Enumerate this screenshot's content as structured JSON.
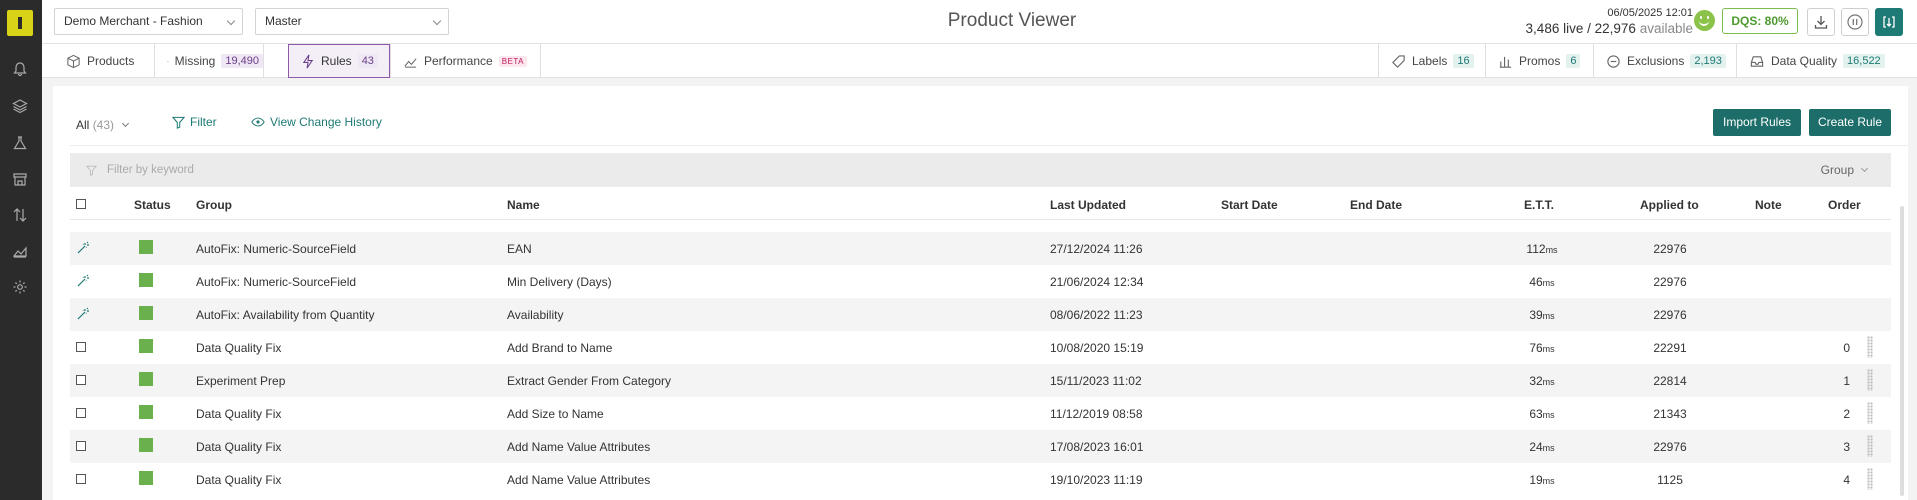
{
  "header": {
    "merchant": "Demo Merchant - Fashion",
    "catalog": "Master",
    "title": "Product Viewer",
    "datetime": "06/05/2025 12:01",
    "live_count": "3,486",
    "live_label": "live /",
    "total_count": "22,976",
    "available_label": "available",
    "dqs": "DQS: 80%"
  },
  "tabs": [
    {
      "label": "Products",
      "icon": "box-icon"
    },
    {
      "label": "Missing",
      "count": "19,490",
      "icon": "missing-icon"
    },
    {
      "label": "Rules",
      "count": "43",
      "icon": "lightning-icon"
    },
    {
      "label": "Performance",
      "beta": "BETA",
      "icon": "chart-icon"
    }
  ],
  "right_tabs": [
    {
      "label": "Labels",
      "count": "16",
      "icon": "tag-icon"
    },
    {
      "label": "Promos",
      "count": "6",
      "icon": "bar-chart-icon"
    },
    {
      "label": "Exclusions",
      "count": "2,193",
      "icon": "minus-circle-icon"
    },
    {
      "label": "Data Quality",
      "count": "16,522",
      "icon": "inbox-icon"
    }
  ],
  "toolbar": {
    "all_label": "All",
    "all_count": "(43)",
    "filter_label": "Filter",
    "history_label": "View Change History",
    "import_label": "Import Rules",
    "create_label": "Create Rule"
  },
  "filterbar": {
    "placeholder": "Filter by keyword",
    "group_label": "Group"
  },
  "table": {
    "headers": {
      "status": "Status",
      "group": "Group",
      "name": "Name",
      "updated": "Last Updated",
      "start": "Start Date",
      "end": "End Date",
      "ett": "E.T.T.",
      "applied": "Applied to",
      "note": "Note",
      "order": "Order"
    },
    "rows": [
      {
        "autofix": true,
        "group": "AutoFix: Numeric-SourceField",
        "name": "EAN",
        "updated": "27/12/2024 11:26",
        "ett": "112",
        "unit": "ms",
        "applied": "22976",
        "order": ""
      },
      {
        "autofix": true,
        "group": "AutoFix: Numeric-SourceField",
        "name": "Min Delivery (Days)",
        "updated": "21/06/2024 12:34",
        "ett": "46",
        "unit": "ms",
        "applied": "22976",
        "order": ""
      },
      {
        "autofix": true,
        "group": "AutoFix: Availability from Quantity",
        "name": "Availability",
        "updated": "08/06/2022 11:23",
        "ett": "39",
        "unit": "ms",
        "applied": "22976",
        "order": ""
      },
      {
        "autofix": false,
        "group": "Data Quality Fix",
        "name": "Add Brand to Name",
        "updated": "10/08/2020 15:19",
        "ett": "76",
        "unit": "ms",
        "applied": "22291",
        "order": "0"
      },
      {
        "autofix": false,
        "group": "Experiment Prep",
        "name": "Extract Gender From Category",
        "updated": "15/11/2023 11:02",
        "ett": "32",
        "unit": "ms",
        "applied": "22814",
        "order": "1"
      },
      {
        "autofix": false,
        "group": "Data Quality Fix",
        "name": "Add Size to Name",
        "updated": "11/12/2019 08:58",
        "ett": "63",
        "unit": "ms",
        "applied": "21343",
        "order": "2"
      },
      {
        "autofix": false,
        "group": "Data Quality Fix",
        "name": "Add Name Value Attributes",
        "updated": "17/08/2023 16:01",
        "ett": "24",
        "unit": "ms",
        "applied": "22976",
        "order": "3"
      },
      {
        "autofix": false,
        "group": "Data Quality Fix",
        "name": "Add Name Value Attributes",
        "updated": "19/10/2023 11:19",
        "ett": "19",
        "unit": "ms",
        "applied": "1125",
        "order": "4"
      }
    ]
  },
  "colors": {
    "accent": "#1d7a74",
    "rules_tab": "#8c5aa8",
    "status_active": "#6ab04c",
    "rail": "#2b2b2b",
    "logo": "#d8d316"
  }
}
